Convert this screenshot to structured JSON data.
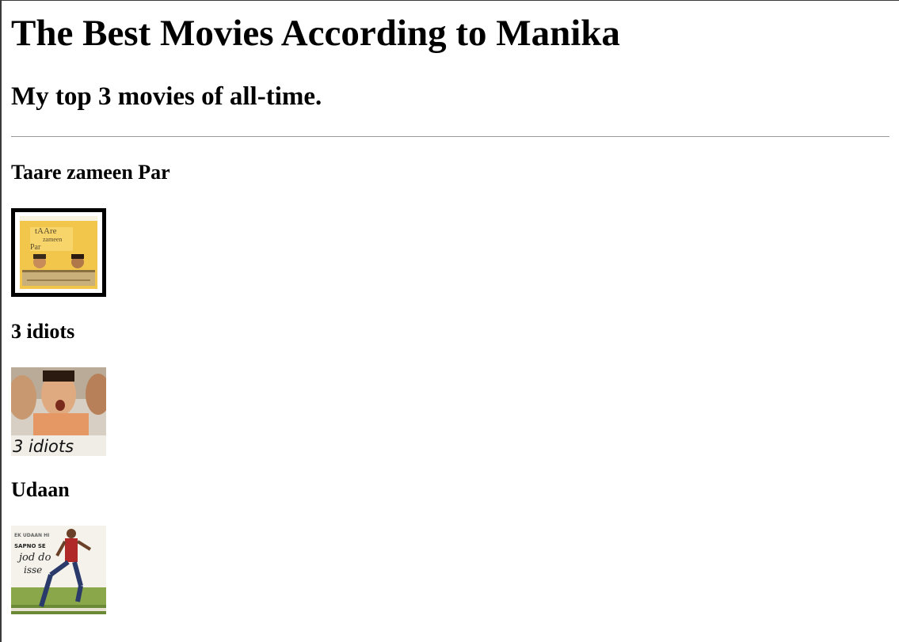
{
  "header": {
    "title": "The Best Movies According to Manika",
    "subtitle": "My top 3 movies of all-time."
  },
  "movies": [
    {
      "title": "Taare zameen Par",
      "poster_text": [
        "tAAre",
        "zameen",
        "Par"
      ]
    },
    {
      "title": "3 idiots",
      "poster_text": [
        "3 idiots"
      ]
    },
    {
      "title": "Udaan",
      "poster_text": [
        "EK UDAAN HI",
        "SAPNO SE",
        "jod do",
        "isse"
      ]
    }
  ]
}
